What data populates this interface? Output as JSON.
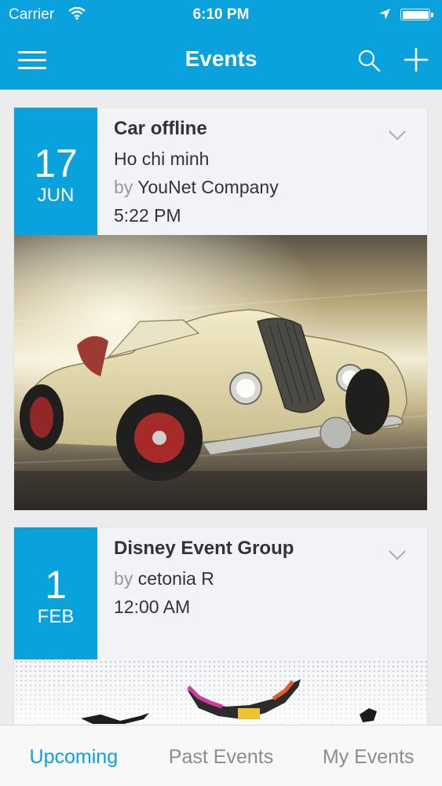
{
  "status_bar": {
    "carrier": "Carrier",
    "time": "6:10 PM"
  },
  "nav": {
    "title": "Events"
  },
  "events": [
    {
      "title": "Car offline",
      "location": "Ho chi minh",
      "by": "by",
      "organizer": "YouNet Company",
      "time": "5:22 PM",
      "day": "17",
      "month": "JUN"
    },
    {
      "title": "Disney Event Group",
      "by": "by",
      "organizer": "cetonia R",
      "time": "12:00 AM",
      "day": "1",
      "month": "FEB"
    }
  ],
  "tabs": [
    {
      "label": "Upcoming",
      "active": true
    },
    {
      "label": "Past Events",
      "active": false
    },
    {
      "label": "My Events",
      "active": false
    }
  ],
  "colors": {
    "accent": "#0aa2dc",
    "inactive_tab": "#8c8c8c"
  }
}
